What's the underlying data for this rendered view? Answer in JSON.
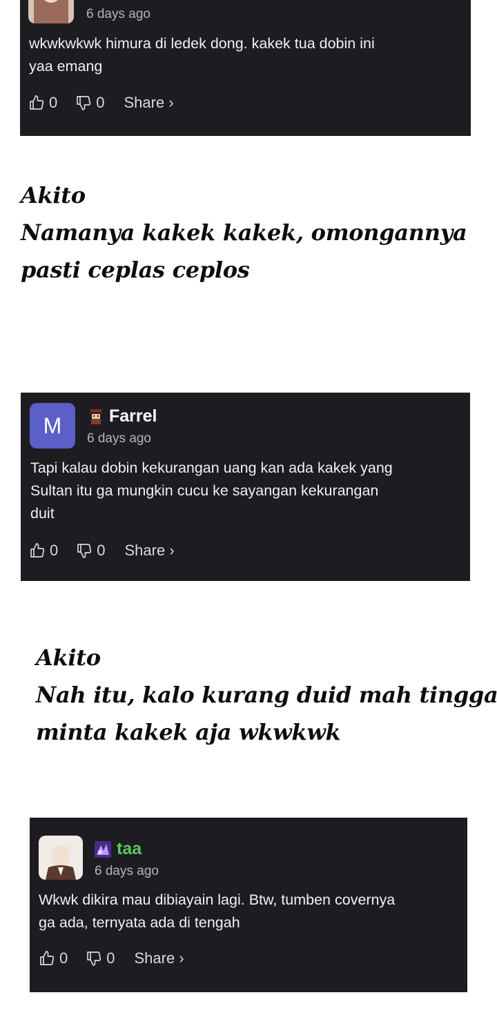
{
  "comments": [
    {
      "user": "",
      "time": "6 days ago",
      "text_lines": [
        "wkwkwkwk himura di ledek dong. kakek tua dobin ini",
        "yaa emang"
      ],
      "likes": "0",
      "dislikes": "0",
      "share": "Share ›"
    },
    {
      "user": "Farrel",
      "avatar_letter": "M",
      "time": "6 days ago",
      "text_lines": [
        "Tapi kalau dobin kekurangan uang kan ada kakek yang",
        "Sultan itu ga mungkin cucu ke sayangan kekurangan",
        "duit"
      ],
      "likes": "0",
      "dislikes": "0",
      "share": "Share ›"
    },
    {
      "user": "taa",
      "time": "6 days ago",
      "text_lines": [
        "Wkwk dikira mau dibiayain lagi. Btw, tumben covernya",
        "ga ada, ternyata ada di tengah"
      ],
      "likes": "0",
      "dislikes": "0",
      "share": "Share ›"
    }
  ],
  "notes": [
    {
      "lines": [
        "Akito",
        "Namanya kakek kakek, omongannya",
        "pasti ceplas ceplos"
      ]
    },
    {
      "lines": [
        "Akito",
        "Nah itu, kalo kurang duid mah tinggal",
        "minta kakek aja wkwkwk"
      ]
    }
  ],
  "colors": {
    "card_bg": "#1d1c21",
    "avatar_purple": "#5b5fc7",
    "username_green": "#5ac85a",
    "time_gray": "#b4b4bc"
  },
  "icons": [
    "thumbs-up-icon",
    "thumbs-down-icon",
    "pirate-badge-icon",
    "anime-badge-icon"
  ]
}
